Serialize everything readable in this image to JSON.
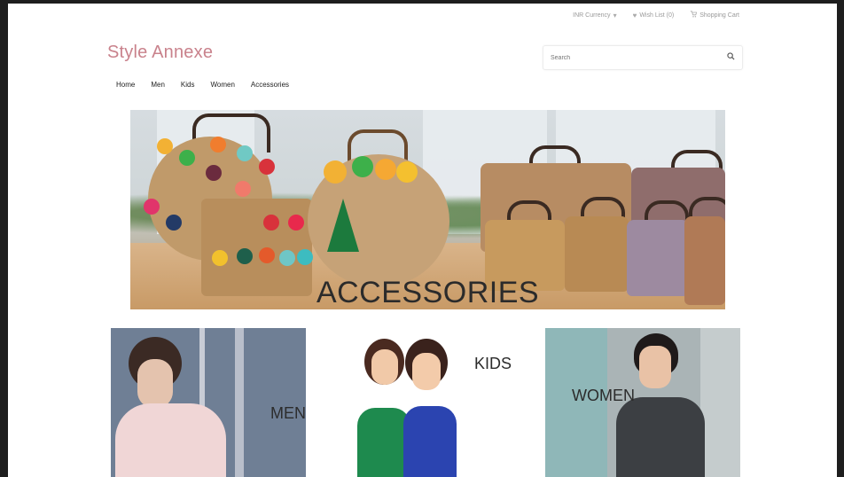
{
  "topbar": {
    "currency": "INR Currency",
    "wishlist": "Wish List (0)",
    "cart": "Shopping Cart"
  },
  "brand": {
    "logo": "Style Annexe"
  },
  "search": {
    "placeholder": "Search"
  },
  "nav": [
    "Home",
    "Men",
    "Kids",
    "Women",
    "Accessories"
  ],
  "banner": {
    "title": "ACCESSORIES"
  },
  "tiles": {
    "men": "MEN",
    "kids": "KIDS",
    "women": "WOMEN"
  },
  "colors": {
    "brand": "#c9828c",
    "text": "#222222",
    "muted": "#999999"
  },
  "icons": {
    "wishlist": "heart-icon",
    "cart": "cart-icon",
    "search": "search-icon",
    "currency": "chevron-down-icon"
  }
}
